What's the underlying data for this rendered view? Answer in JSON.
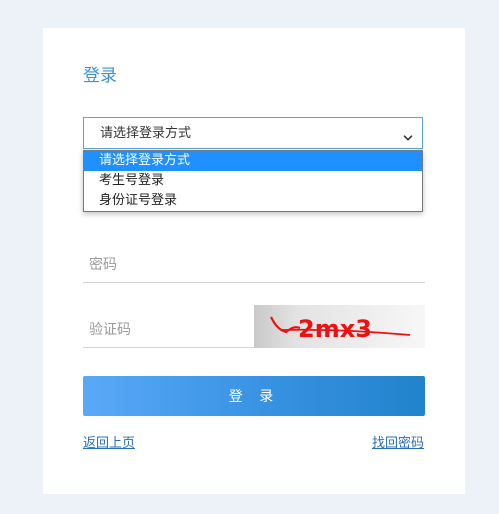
{
  "login": {
    "title": "登录",
    "select": {
      "value": "请选择登录方式",
      "options": [
        "请选择登录方式",
        "考生号登录",
        "身份证号登录"
      ]
    },
    "password": {
      "placeholder": "密码",
      "value": ""
    },
    "captcha": {
      "placeholder": "验证码",
      "value": "",
      "image_text": "2mx3"
    },
    "submit_label": "登 录",
    "back_link": "返回上页",
    "forgot_link": "找回密码"
  },
  "colors": {
    "title": "#3f8fd8",
    "button_start": "#5aa9f8",
    "button_end": "#2183cc",
    "dropdown_selected": "#1e90ff",
    "link": "#2a6fb5",
    "page_bg": "#edf2f9"
  }
}
